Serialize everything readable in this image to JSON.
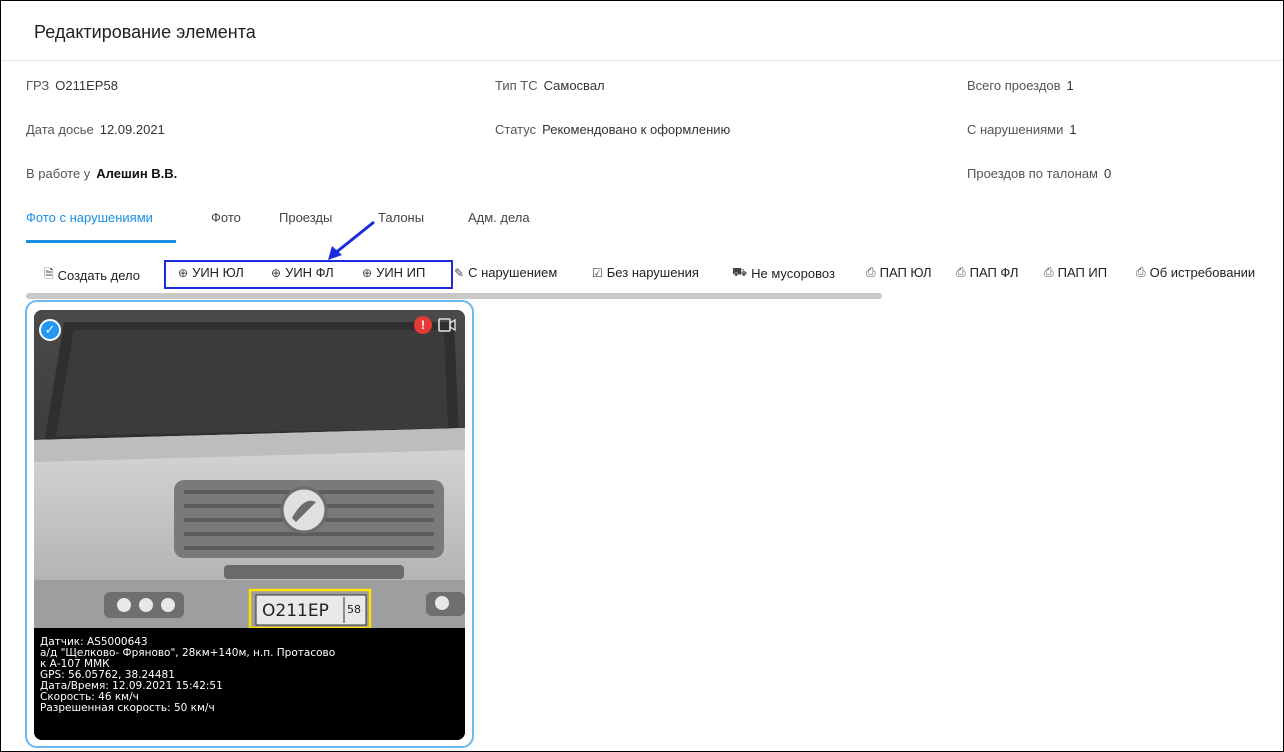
{
  "header": {
    "title": "Редактирование элемента"
  },
  "fields": {
    "grz": {
      "label": "ГРЗ",
      "value": "О211ЕР58"
    },
    "vehicle_type": {
      "label": "Тип ТС",
      "value": "Самосвал"
    },
    "total_passes": {
      "label": "Всего проездов",
      "value": "1"
    },
    "dossier_date": {
      "label": "Дата досье",
      "value": "12.09.2021"
    },
    "status": {
      "label": "Статус",
      "value": "Рекомендовано к оформлению"
    },
    "with_violations": {
      "label": "С нарушениями",
      "value": "1"
    },
    "in_work": {
      "label": "В работе у",
      "value": "Алешин В.В."
    },
    "coupon_passes": {
      "label": "Проездов по талонам",
      "value": "0"
    }
  },
  "tabs": [
    {
      "label": "Фото с нарушениями",
      "active": true
    },
    {
      "label": "Фото",
      "active": false
    },
    {
      "label": "Проезды",
      "active": false
    },
    {
      "label": "Талоны",
      "active": false
    },
    {
      "label": "Адм. дела",
      "active": false
    }
  ],
  "toolbar": [
    {
      "label": "Создать дело",
      "icon": "document-icon",
      "glyph": "🗎"
    },
    {
      "label": "УИН ЮЛ",
      "icon": "plus-circle-icon",
      "glyph": "⊕"
    },
    {
      "label": "УИН ФЛ",
      "icon": "plus-circle-icon",
      "glyph": "⊕"
    },
    {
      "label": "УИН ИП",
      "icon": "plus-circle-icon",
      "glyph": "⊕"
    },
    {
      "label": "С нарушением",
      "icon": "edit-icon",
      "glyph": "✎"
    },
    {
      "label": "Без нарушения",
      "icon": "message-check-icon",
      "glyph": "☑"
    },
    {
      "label": "Не мусоровоз",
      "icon": "bus-icon",
      "glyph": "⛟"
    },
    {
      "label": "ПАП ЮЛ",
      "icon": "printer-icon",
      "glyph": "⎙"
    },
    {
      "label": "ПАП ФЛ",
      "icon": "printer-icon",
      "glyph": "⎙"
    },
    {
      "label": "ПАП ИП",
      "icon": "printer-icon",
      "glyph": "⎙"
    },
    {
      "label": "Об истребовании",
      "icon": "printer-icon",
      "glyph": "⎙"
    }
  ],
  "photo": {
    "plate": {
      "main": "О211ЕР",
      "region": "58"
    },
    "caption": [
      "Датчик: AS5000643",
      "а/д \"Щелково- Фряново\", 28км+140м, н.п. Протасово",
      "к А-107 ММК",
      "GPS: 56.05762, 38.24481",
      "Дата/Время: 12.09.2021 15:42:51",
      "Скорость: 46 км/ч",
      "Разрешенная скорость: 50 км/ч"
    ],
    "selected": true
  },
  "colors": {
    "accent": "#1a8fe3",
    "highlight_box": "#1a2bdb",
    "plate_box": "#ffe100",
    "alert": "#e53935"
  }
}
